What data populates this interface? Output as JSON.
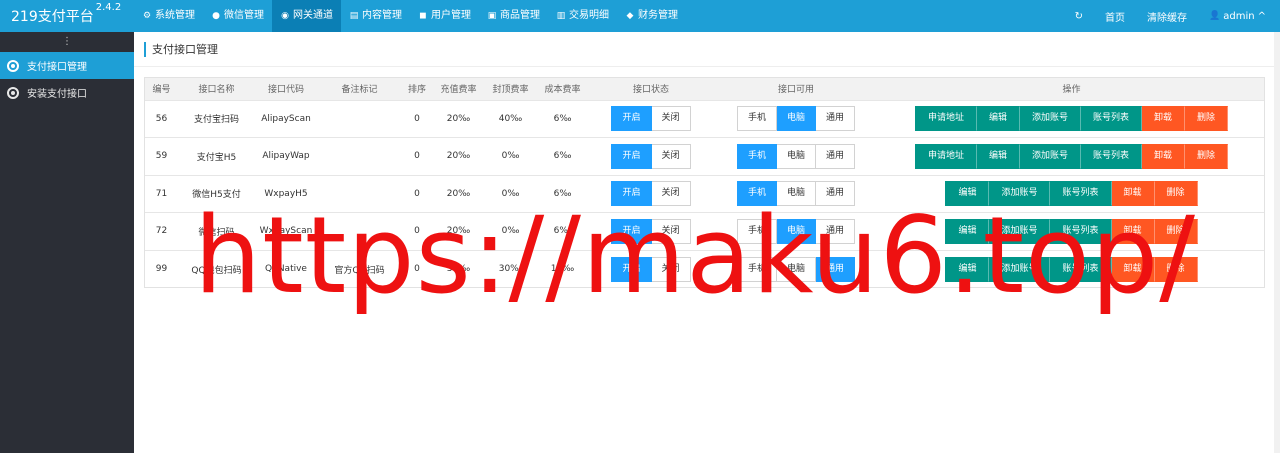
{
  "app": {
    "title": "219支付平台",
    "version": "2.4.2"
  },
  "topnav": [
    {
      "icon": "gear-icon",
      "glyph": "⚙",
      "label": "系统管理",
      "active": false
    },
    {
      "icon": "chat-icon",
      "glyph": "●",
      "label": "微信管理",
      "active": false
    },
    {
      "icon": "compass-icon",
      "glyph": "◉",
      "label": "网关通道",
      "active": true
    },
    {
      "icon": "file-icon",
      "glyph": "▤",
      "label": "内容管理",
      "active": false
    },
    {
      "icon": "users-icon",
      "glyph": "◼",
      "label": "用户管理",
      "active": false
    },
    {
      "icon": "store-icon",
      "glyph": "▣",
      "label": "商品管理",
      "active": false
    },
    {
      "icon": "chart-icon",
      "glyph": "▥",
      "label": "交易明细",
      "active": false
    },
    {
      "icon": "money-icon",
      "glyph": "◆",
      "label": "财务管理",
      "active": false
    }
  ],
  "topright": {
    "refresh_glyph": "↻",
    "home": "首页",
    "clear_cache": "清除缓存",
    "user_glyph": "👤",
    "user": "admin",
    "user_caret": "^"
  },
  "sidebar": {
    "toggle": "⋮",
    "items": [
      {
        "label": "支付接口管理",
        "active": true
      },
      {
        "label": "安装支付接口",
        "active": false
      }
    ]
  },
  "page": {
    "title": "支付接口管理"
  },
  "table": {
    "headers": [
      "编号",
      "接口名称",
      "接口代码",
      "备注标记",
      "排序",
      "充值费率",
      "封顶费率",
      "成本费率",
      "接口状态",
      "接口可用",
      "操作"
    ],
    "rows": [
      {
        "id": "56",
        "name": "支付宝扫码",
        "code": "AlipayScan",
        "remark": "",
        "sort": "0",
        "rate": "20‰",
        "cap": "40‰",
        "cost": "6‰",
        "status_on": "开启",
        "status_off": "关闭",
        "status": "on",
        "avail_phone": "手机",
        "avail_pc": "电脑",
        "avail_all": "通用",
        "avail": "pc",
        "ops": [
          "申请地址",
          "编辑",
          "添加账号",
          "账号列表",
          "卸载",
          "删除"
        ]
      },
      {
        "id": "59",
        "name": "支付宝H5",
        "code": "AlipayWap",
        "remark": "",
        "sort": "0",
        "rate": "20‰",
        "cap": "0‰",
        "cost": "6‰",
        "status_on": "开启",
        "status_off": "关闭",
        "status": "on",
        "avail_phone": "手机",
        "avail_pc": "电脑",
        "avail_all": "通用",
        "avail": "phone",
        "ops": [
          "申请地址",
          "编辑",
          "添加账号",
          "账号列表",
          "卸载",
          "删除"
        ]
      },
      {
        "id": "71",
        "name": "微信H5支付",
        "code": "WxpayH5",
        "remark": "",
        "sort": "0",
        "rate": "20‰",
        "cap": "0‰",
        "cost": "6‰",
        "status_on": "开启",
        "status_off": "关闭",
        "status": "on",
        "avail_phone": "手机",
        "avail_pc": "电脑",
        "avail_all": "通用",
        "avail": "phone",
        "ops": [
          "编辑",
          "添加账号",
          "账号列表",
          "卸载",
          "删除"
        ]
      },
      {
        "id": "72",
        "name": "微信扫码",
        "code": "WxpayScan",
        "remark": "",
        "sort": "0",
        "rate": "20‰",
        "cap": "0‰",
        "cost": "6‰",
        "status_on": "开启",
        "status_off": "关闭",
        "status": "on",
        "avail_phone": "手机",
        "avail_pc": "电脑",
        "avail_all": "通用",
        "avail": "pc",
        "ops": [
          "编辑",
          "添加账号",
          "账号列表",
          "卸载",
          "删除"
        ]
      },
      {
        "id": "99",
        "name": "QQ钱包扫码",
        "code": "QqNative",
        "remark": "官方QQ扫码",
        "sort": "0",
        "rate": "30‰",
        "cap": "30‰",
        "cost": "10‰",
        "status_on": "开启",
        "status_off": "关闭",
        "status": "on",
        "avail_phone": "手机",
        "avail_pc": "电脑",
        "avail_all": "通用",
        "avail": "all",
        "ops": [
          "编辑",
          "添加账号",
          "账号列表",
          "卸载",
          "删除"
        ]
      }
    ]
  },
  "watermark": "https://maku6.top/",
  "colors": {
    "primary": "#1e9fd6",
    "active_btn": "#1e9fff",
    "teal": "#009688",
    "orange": "#ff5722",
    "sidebar_bg": "#2b2e36",
    "watermark": "#ee1111"
  }
}
